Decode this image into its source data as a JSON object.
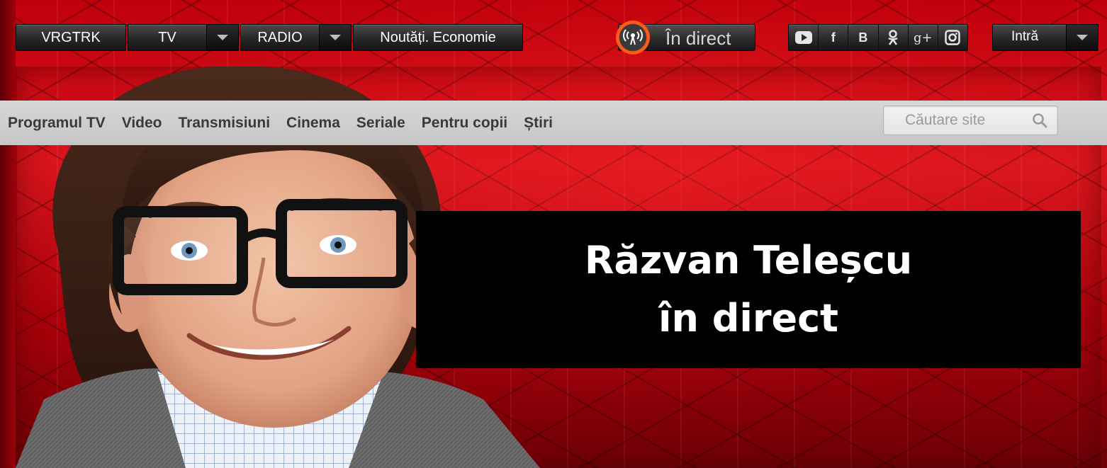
{
  "top_nav": {
    "items": [
      {
        "label": "VRGTRK",
        "has_dropdown": false
      },
      {
        "label": "TV",
        "has_dropdown": true
      },
      {
        "label": "RADIO",
        "has_dropdown": true
      },
      {
        "label": "Noutăți. Economie",
        "has_dropdown": false
      }
    ]
  },
  "live": {
    "label": "În direct",
    "icon": "broadcast-icon",
    "accent": "#ff5a1a"
  },
  "social": [
    {
      "name": "youtube-icon",
      "glyph": ""
    },
    {
      "name": "facebook-icon",
      "glyph": "f"
    },
    {
      "name": "vk-icon",
      "glyph": "B"
    },
    {
      "name": "odnoklassniki-icon",
      "glyph": ""
    },
    {
      "name": "google-plus-icon",
      "glyph": "g+"
    },
    {
      "name": "instagram-icon",
      "glyph": ""
    }
  ],
  "login": {
    "label": "Intră"
  },
  "secondary_nav": {
    "items": [
      "Programul TV",
      "Video",
      "Transmisiuni",
      "Cinema",
      "Seriale",
      "Pentru copii",
      "Știri"
    ]
  },
  "search": {
    "placeholder": "Căutare site"
  },
  "banner": {
    "line1": "Răzvan Teleșcu",
    "line2": "în direct",
    "background_color": "#c8000c"
  }
}
